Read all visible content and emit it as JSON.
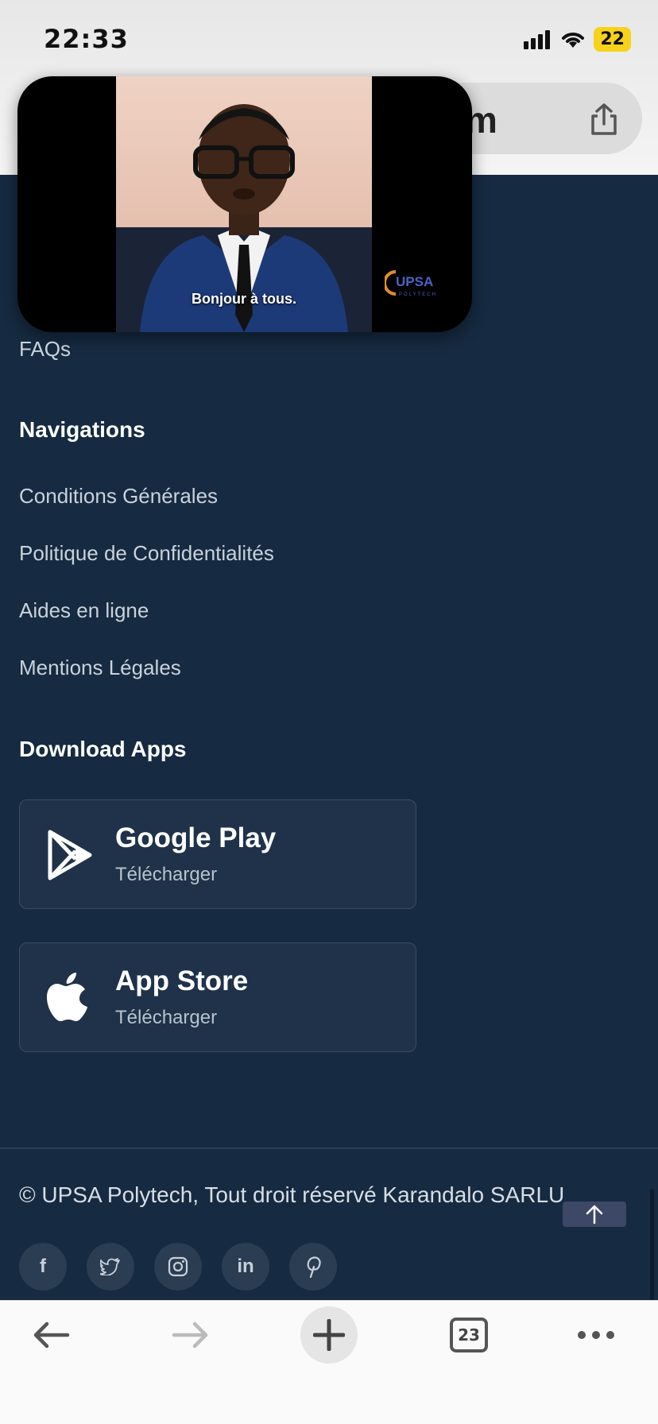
{
  "status_bar": {
    "time": "22:33",
    "battery": "22"
  },
  "browser": {
    "url_fragment": "m",
    "tab_count": "23"
  },
  "video": {
    "caption": "Bonjour à tous.",
    "logo_text": "UPSA",
    "logo_subtext": "POLYTECH"
  },
  "footer": {
    "faq_link": "FAQs",
    "navigations_heading": "Navigations",
    "nav_links": [
      "Conditions Générales",
      "Politique de Confidentialités",
      "Aides en ligne",
      "Mentions Légales"
    ],
    "download_heading": "Download Apps",
    "apps": [
      {
        "name": "Google Play",
        "sub": "Télécharger",
        "icon": "google-play-icon"
      },
      {
        "name": "App Store",
        "sub": "Télécharger",
        "icon": "apple-icon"
      }
    ],
    "copyright": "© UPSA Polytech, Tout droit réservé Karandalo SARLU",
    "socials": [
      {
        "icon": "facebook-icon",
        "glyph": "f"
      },
      {
        "icon": "twitter-icon",
        "glyph": ""
      },
      {
        "icon": "instagram-icon",
        "glyph": ""
      },
      {
        "icon": "linkedin-icon",
        "glyph": "in"
      },
      {
        "icon": "pinterest-icon",
        "glyph": "P"
      }
    ]
  },
  "colors": {
    "background": "#162a41",
    "card": "#1f3249",
    "battery": "#f7d21a"
  }
}
